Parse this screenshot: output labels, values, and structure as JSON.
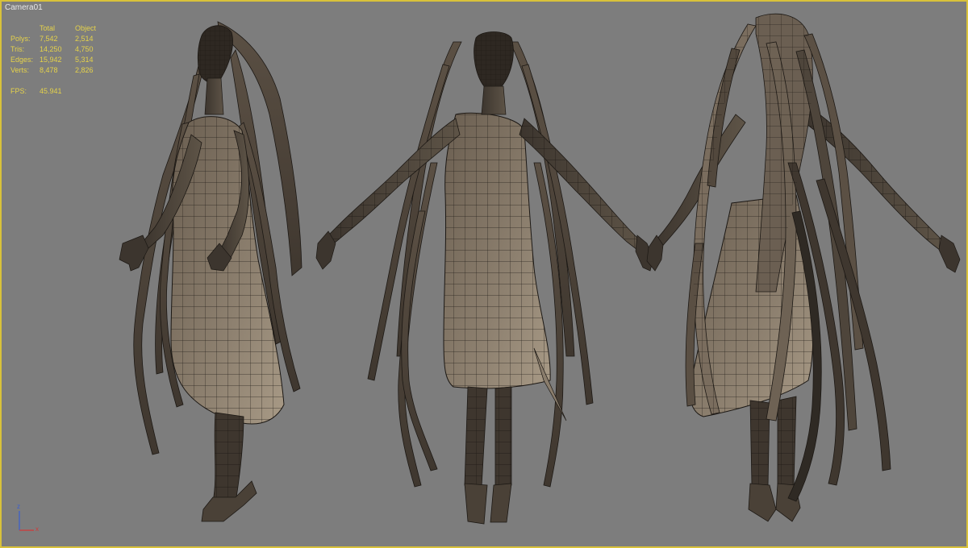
{
  "viewport": {
    "label": "Camera01"
  },
  "stats": {
    "columns": [
      "",
      "Total",
      "Object"
    ],
    "rows": [
      {
        "label": "Polys:",
        "total": "7,542",
        "object": "2,514"
      },
      {
        "label": "Tris:",
        "total": "14,250",
        "object": "4,750"
      },
      {
        "label": "Edges:",
        "total": "15,942",
        "object": "5,314"
      },
      {
        "label": "Verts:",
        "total": "8,478",
        "object": "2,826"
      }
    ],
    "fps_label": "FPS:",
    "fps_value": "45.941"
  },
  "gizmo": {
    "z": "z",
    "x": "x"
  },
  "colors": {
    "background": "#7d7d7d",
    "border": "#d8c23a",
    "stats_text": "#e5d24a",
    "mesh_fill": "#5a4f44",
    "mesh_light": "#8f8272",
    "wire": "#1c1814"
  }
}
